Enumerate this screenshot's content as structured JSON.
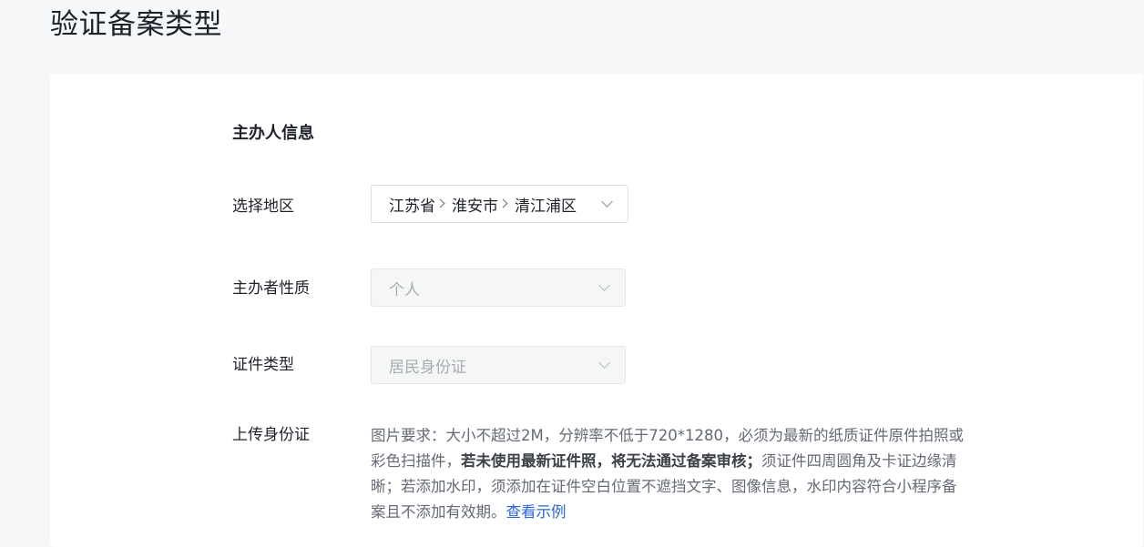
{
  "page": {
    "title": "验证备案类型"
  },
  "section": {
    "title": "主办人信息"
  },
  "fields": {
    "region": {
      "label": "选择地区",
      "province": "江苏省",
      "city": "淮安市",
      "district": "清江浦区"
    },
    "organizer_type": {
      "label": "主办者性质",
      "value": "个人"
    },
    "id_type": {
      "label": "证件类型",
      "value": "居民身份证"
    },
    "upload": {
      "label": "上传身份证",
      "requirement_part1": "图片要求：大小不超过2M，分辨率不低于720*1280，必须为最新的纸质证件原件拍照或彩色扫描件，",
      "requirement_bold": "若未使用最新证件照，将无法通过备案审核；",
      "requirement_part2": "须证件四周圆角及卡证边缘清晰；若添加水印，须添加在证件空白位置不遮挡文字、图像信息，水印内容符合小程序备案且不添加有效期。",
      "example_link": "查看示例"
    }
  },
  "icons": {
    "dropdown": "chevron-down-icon",
    "separator": "chevron-right-icon"
  },
  "colors": {
    "link": "#2a64d6",
    "disabled_bg": "#f5f7f7"
  }
}
